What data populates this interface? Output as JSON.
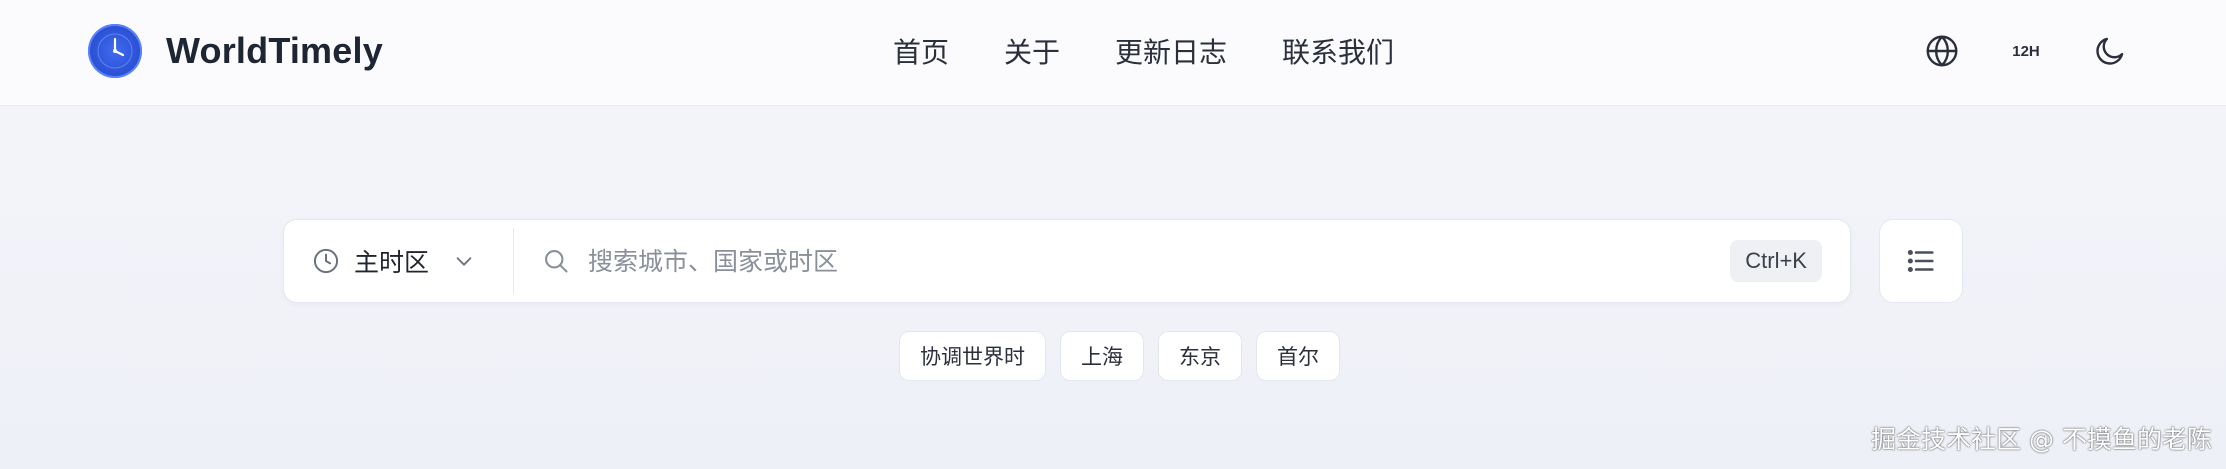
{
  "header": {
    "brand": "WorldTimely",
    "nav": [
      {
        "label": "首页"
      },
      {
        "label": "关于"
      },
      {
        "label": "更新日志"
      },
      {
        "label": "联系我们"
      }
    ],
    "language_icon": "globe-icon",
    "time_format_label": "12H",
    "theme_icon": "moon-icon"
  },
  "search": {
    "timezone_label": "主时区",
    "placeholder": "搜索城市、国家或时区",
    "shortcut": "Ctrl+K",
    "list_icon": "list-icon"
  },
  "quick_zones": [
    {
      "label": "协调世界时"
    },
    {
      "label": "上海"
    },
    {
      "label": "东京"
    },
    {
      "label": "首尔"
    }
  ],
  "watermark": "掘金技术社区 @ 不摸鱼的老陈",
  "colors": {
    "accent": "#2c52d6",
    "text": "#1f2430",
    "muted": "#8a8f9c",
    "background": "#f2f3f9"
  }
}
